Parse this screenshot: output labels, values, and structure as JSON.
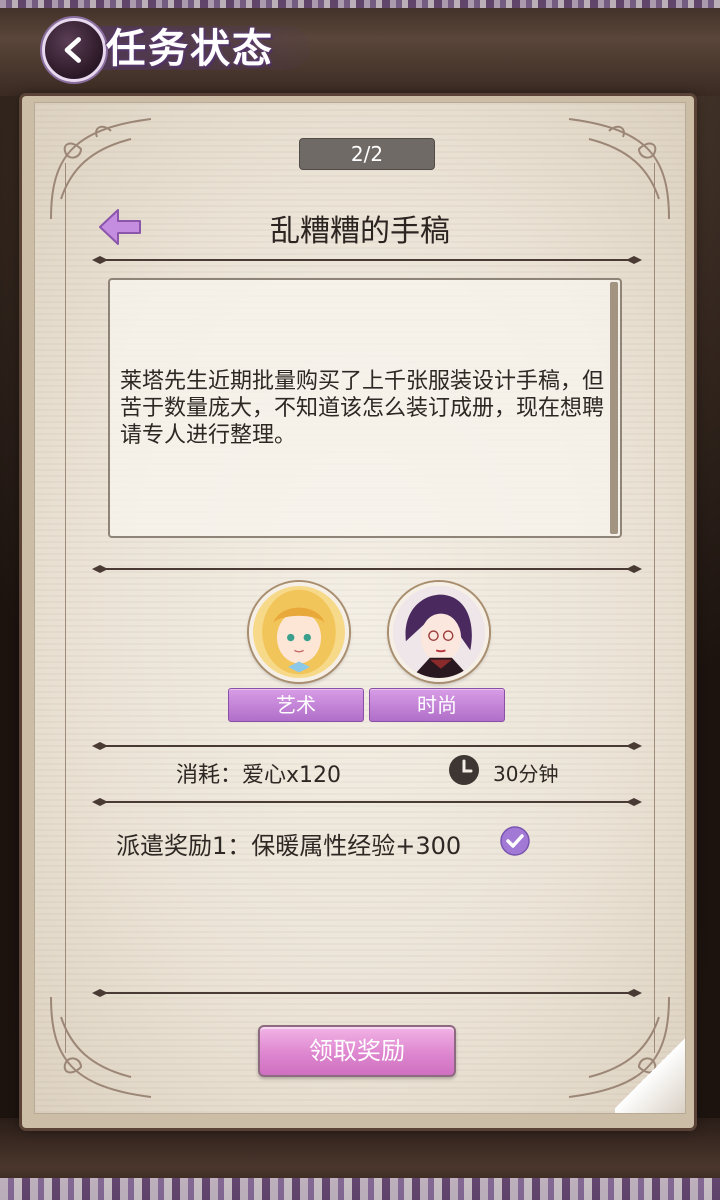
{
  "header": {
    "title": "任务状态",
    "back_icon": "chevron-left-icon"
  },
  "task": {
    "counter": "2/2",
    "title": "乱糟糟的手稿",
    "description": "莱塔先生近期批量购买了上千张服装设计手稿，但苦于数量庞大，不知道该怎么装订成册，现在想聘请专人进行整理。",
    "characters": [
      {
        "avatar_icon": "blonde-girl-avatar-icon",
        "tag": "艺术"
      },
      {
        "avatar_icon": "purple-hair-lady-avatar-icon",
        "tag": "时尚"
      }
    ],
    "cost": "消耗：爱心x120",
    "duration": "30分钟",
    "reward": "派遣奖励1：保暖属性经验+300",
    "reward_completed": true,
    "claim_button": "领取奖励"
  },
  "colors": {
    "accent_purple": "#b06fc9",
    "button_pink": "#de86cf",
    "text_dark": "#2e2824"
  }
}
